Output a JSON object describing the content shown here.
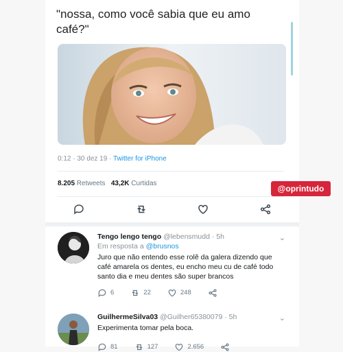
{
  "tweet": {
    "text": "\"nossa, como você sabia que eu amo café?\"",
    "timestamp": "0:12 · 30 dez 19 · ",
    "source": "Twitter for iPhone",
    "retweets_count": "8.205",
    "retweets_label": " Retweets",
    "likes_count": "43,2K",
    "likes_label": " Curtidas"
  },
  "watermark": "@oprintudo",
  "replies": [
    {
      "name": "Tengo lengo tengo",
      "handle": "@lebensmudd",
      "time": "· 5h",
      "in_reply_prefix": "Em resposta a ",
      "in_reply_to": "@brusnos",
      "text": "Juro que não entendo esse rolê da galera dizendo que café amarela os dentes, eu encho meu cu de café todo santo dia e meu dentes são super brancos",
      "reply_count": "6",
      "retweet_count": "22",
      "like_count": "248"
    },
    {
      "name": "GuilhermeSilva03",
      "handle": "@Guilher65380079",
      "time": "· 5h",
      "text": "Experimenta tomar pela boca.",
      "reply_count": "81",
      "retweet_count": "127",
      "like_count": "2.656"
    }
  ],
  "colors": {
    "link": "#1b95e0",
    "watermark_bg": "#d6263b"
  }
}
